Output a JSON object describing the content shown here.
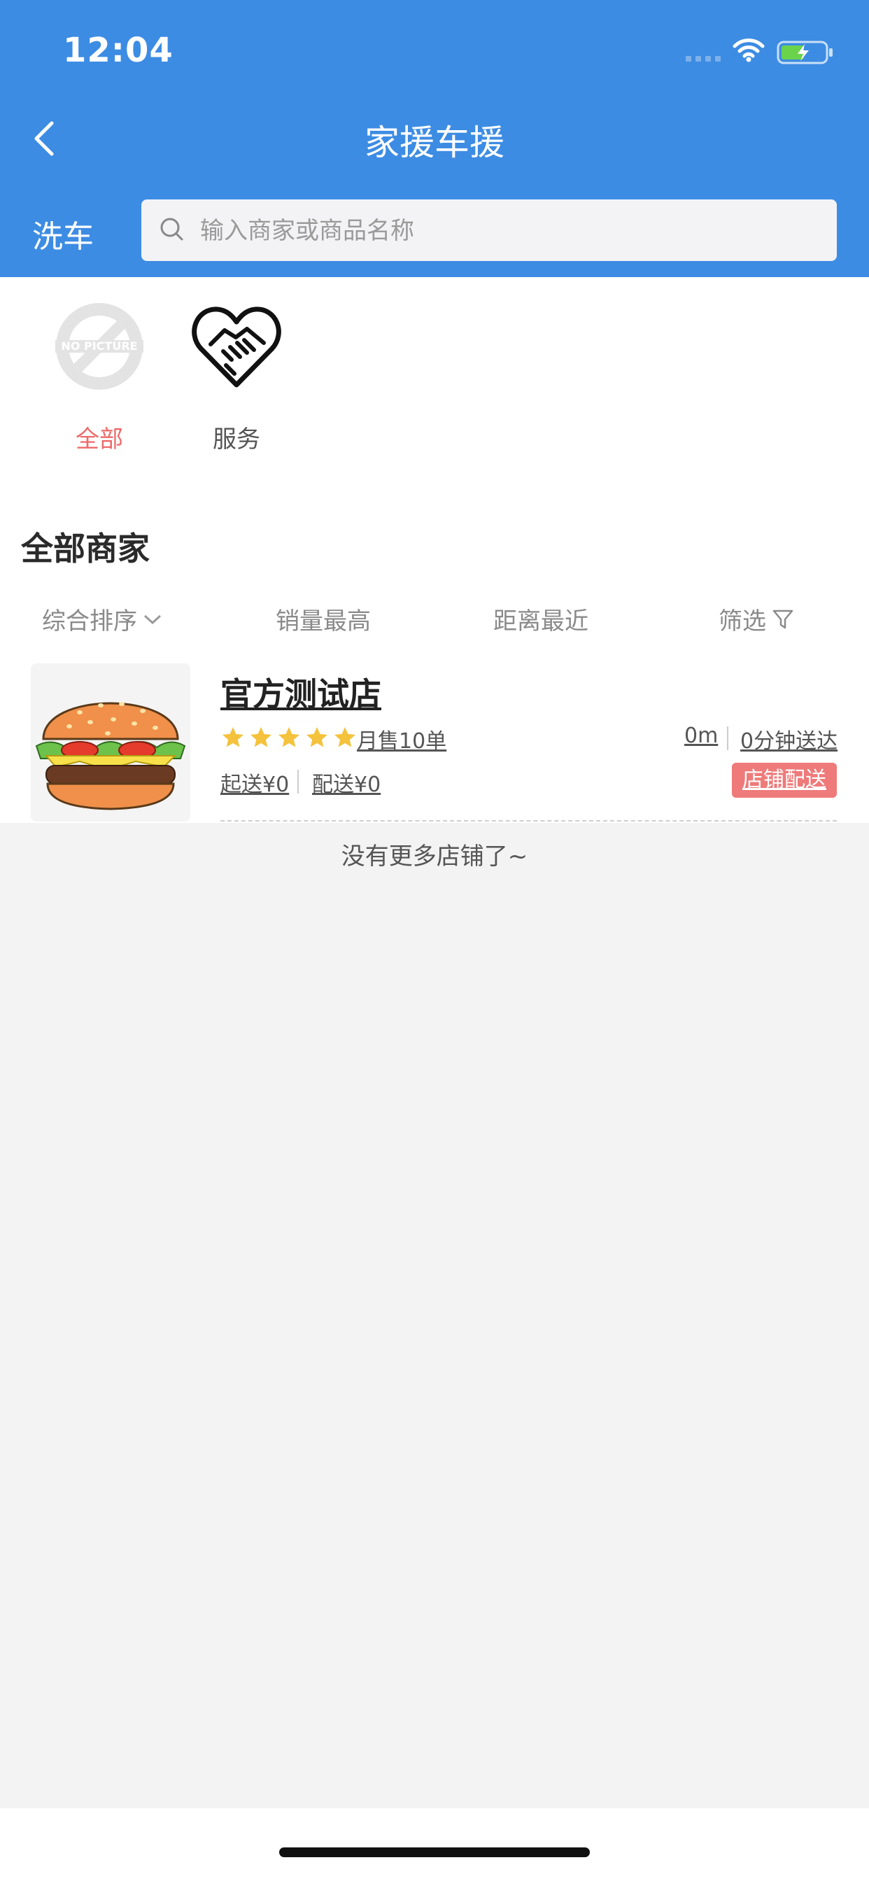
{
  "status_bar": {
    "time": "12:04"
  },
  "header": {
    "title": "家援车援",
    "city": "洗车"
  },
  "search": {
    "placeholder": "输入商家或商品名称"
  },
  "categories": [
    {
      "label": "全部",
      "image": "no-picture",
      "active": true
    },
    {
      "label": "服务",
      "image": "handshake-heart-icon",
      "active": false
    }
  ],
  "section": {
    "title": "全部商家"
  },
  "sort": {
    "items": [
      "综合排序",
      "销量最高",
      "距离最近",
      "筛选"
    ]
  },
  "store": {
    "name": "官方测试店",
    "rating": 5,
    "monthly_sales": "月售10单",
    "distance": "0m",
    "delivery_time": "0分钟送达",
    "min_order": "起送¥0",
    "delivery_fee": "配送¥0",
    "badge": "店铺配送"
  },
  "footer": {
    "no_more": "没有更多店铺了~"
  },
  "colors": {
    "header": "#3d8ce3",
    "accent": "#ee6a6a",
    "star": "#f4c23c"
  }
}
